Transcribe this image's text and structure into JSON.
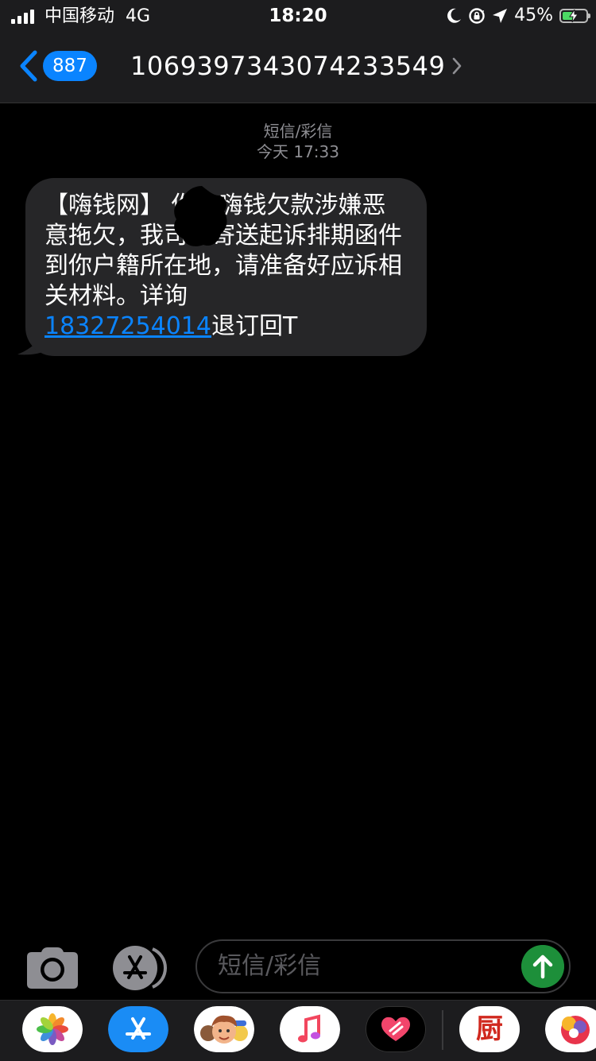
{
  "status_bar": {
    "carrier": "中国移动",
    "network": "4G",
    "time": "18:20",
    "battery_percent": "45%",
    "battery_level": 0.45,
    "icons": [
      "signal-icon",
      "moon-icon",
      "rotation-lock-icon",
      "location-icon",
      "battery-charging-icon"
    ]
  },
  "nav": {
    "back_badge": "887",
    "contact_number": "1069397343074233549"
  },
  "thread": {
    "type_label": "短信/彩信",
    "timestamp": "今天 17:33"
  },
  "message": {
    "text_before_link": "【嗨钱网】 你在嗨钱欠款涉嫌恶意拖欠，我司已寄送起诉排期函件到你户籍所在地，请准备好应诉相关材料。详询",
    "link": "18327254014",
    "text_after_link": "退订回T"
  },
  "input": {
    "placeholder": "短信/彩信"
  },
  "app_drawer": {
    "apps": [
      "photos-app-icon",
      "app-store-app-icon",
      "memoji-app-icon",
      "music-app-icon",
      "digital-touch-app-icon",
      "xiachufang-app-icon",
      "colorful-app-icon"
    ],
    "xiachufang_label": "厨"
  },
  "colors": {
    "accent": "#0a84ff",
    "bubble": "#262628",
    "send": "#1d8f3a",
    "bar": "#1c1c1e"
  }
}
